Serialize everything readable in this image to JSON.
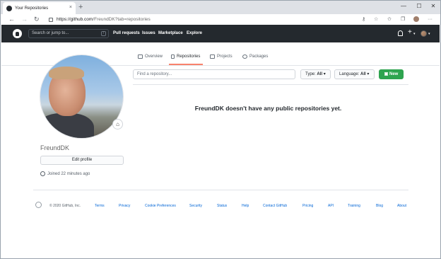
{
  "browser": {
    "tab_title": "Your Repositories",
    "close_glyph": "×",
    "new_tab_glyph": "+",
    "url_host": "https://github.com",
    "url_path": "/FreundDK?tab=repositories",
    "window_controls": [
      "—",
      "☐",
      "✕"
    ],
    "more_glyph": "···"
  },
  "header": {
    "search_placeholder": "Search or jump to...",
    "search_shortcut": "/",
    "nav": [
      "Pull requests",
      "Issues",
      "Marketplace",
      "Explore"
    ],
    "plus_glyph": "+",
    "caret_glyph": "▾"
  },
  "profile_tabs": [
    {
      "label": "Overview",
      "active": false
    },
    {
      "label": "Repositories",
      "active": true
    },
    {
      "label": "Projects",
      "active": false
    },
    {
      "label": "Packages",
      "active": false
    }
  ],
  "profile": {
    "username": "FreundDK",
    "edit_label": "Edit profile",
    "joined": "Joined 22 minutes ago",
    "status_glyph": "⌂"
  },
  "repos": {
    "find_placeholder": "Find a repository...",
    "type_label": "Type:",
    "type_value": "All",
    "language_label": "Language:",
    "language_value": "All",
    "caret": "▾",
    "new_label": "New",
    "empty_message": "FreundDK doesn't have any public repositories yet."
  },
  "footer": {
    "copyright": "© 2020 GitHub, Inc.",
    "links": [
      "Terms",
      "Privacy",
      "Cookie Preferences",
      "Security",
      "Status",
      "Help",
      "Contact GitHub",
      "Pricing",
      "API",
      "Training",
      "Blog",
      "About"
    ]
  },
  "colors": {
    "header_bg": "#24292e",
    "new_button": "#2ea44f",
    "active_tab_underline": "#f9826c",
    "link": "#0366d6"
  }
}
